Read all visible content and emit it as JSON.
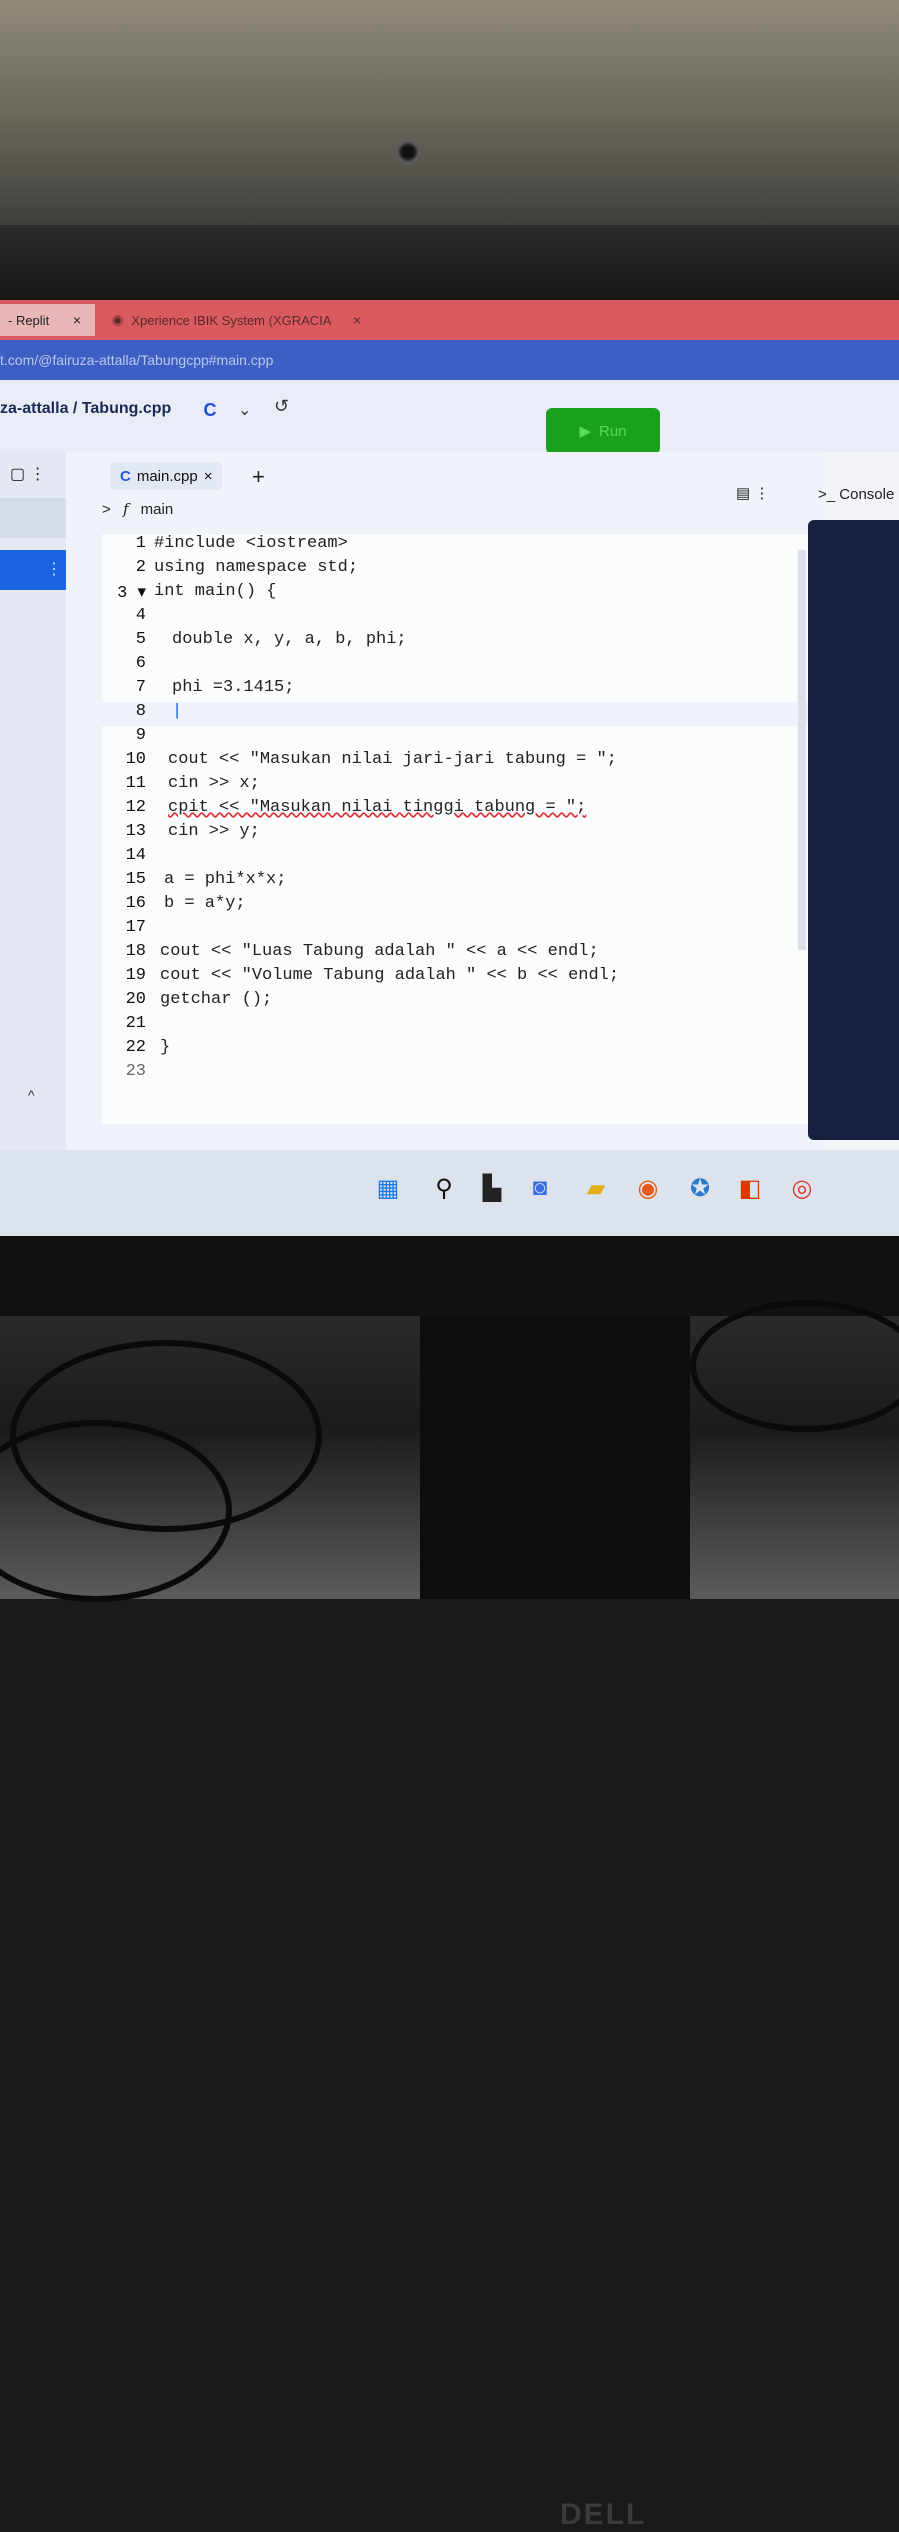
{
  "browser": {
    "tabs": [
      {
        "label": "- Replit",
        "close": "×"
      },
      {
        "label": "Xperience IBIK System (XGRACIA",
        "close": "×"
      }
    ],
    "url": "t.com/@fairuza-attalla/Tabungcpp#main.cpp"
  },
  "header": {
    "project": "za-attalla / Tabung.cpp",
    "lang_badge": "C",
    "chevron": "⌄",
    "history_icon": "↺",
    "run_label": "Run",
    "run_icon": "▶"
  },
  "editor": {
    "file_tab": "main.cpp",
    "file_tab_close": "×",
    "add_tab": "+",
    "breadcrumb_chevron": ">",
    "breadcrumb_f": "f",
    "breadcrumb_fn": "main",
    "tools": "⋮",
    "lines": [
      {
        "n": "1",
        "text": "#include <iostream>"
      },
      {
        "n": "2",
        "text": "using namespace std;"
      },
      {
        "n": "3 ▾",
        "text": "int main() {"
      },
      {
        "n": "4",
        "text": ""
      },
      {
        "n": "5",
        "text": "double x, y, a, b, phi;"
      },
      {
        "n": "6",
        "text": ""
      },
      {
        "n": "7",
        "text": "phi =3.1415;"
      },
      {
        "n": "8",
        "text": "|"
      },
      {
        "n": "9",
        "text": ""
      },
      {
        "n": "10",
        "text": "cout << \"Masukan nilai jari-jari tabung = \";"
      },
      {
        "n": "11",
        "text": "cin >> x;"
      },
      {
        "n": "12",
        "text": "cpit << \"Masukan nilai tinggi tabung = \";"
      },
      {
        "n": "13",
        "text": "cin >> y;"
      },
      {
        "n": "14",
        "text": ""
      },
      {
        "n": "15",
        "text": "a = phi*x*x;"
      },
      {
        "n": "16",
        "text": "b = a*y;"
      },
      {
        "n": "17",
        "text": ""
      },
      {
        "n": "18",
        "text": "cout << \"Luas Tabung adalah \" << a << endl;"
      },
      {
        "n": "19",
        "text": "cout << \"Volume Tabung adalah \" << b << endl;"
      },
      {
        "n": "20",
        "text": "getchar ();"
      },
      {
        "n": "21",
        "text": ""
      },
      {
        "n": "22",
        "text": "}"
      },
      {
        "n": "23",
        "text": ""
      }
    ]
  },
  "console": {
    "label": ">_ Console"
  },
  "monitor": {
    "brand": "DELL"
  },
  "colors": {
    "run": "#1ba01e",
    "console_bg": "#17213d",
    "tabbar": "#d95b5f",
    "urlbar": "#3d5fc4"
  },
  "taskbar_icons": [
    "windows-start-icon",
    "search-icon",
    "widgets-icon",
    "chat-icon",
    "file-explorer-icon",
    "firefox-icon",
    "app-icon",
    "office-icon",
    "chrome-icon"
  ]
}
